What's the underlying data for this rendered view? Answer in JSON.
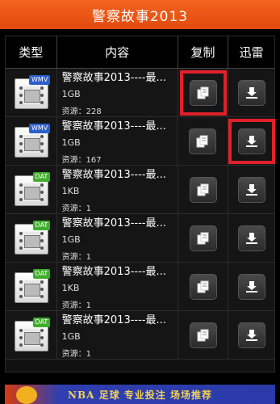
{
  "title": "警察故事2013",
  "headers": {
    "type": "类型",
    "content": "内容",
    "copy": "复制",
    "download": "迅雷"
  },
  "colors": {
    "title_bar": "#e94f12",
    "highlight": "#e0202a",
    "wmv_tag": "#2c5fc9",
    "dat_tag": "#3fae2a"
  },
  "rows": [
    {
      "type_tag": "WMV",
      "name": "警察故事2013----最...",
      "size": "1GB",
      "source": "资源：228"
    },
    {
      "type_tag": "WMV",
      "name": "警察故事2013----最...",
      "size": "1GB",
      "source": "资源：167"
    },
    {
      "type_tag": "DAT",
      "name": "警察故事2013----最...",
      "size": "1KB",
      "source": "资源：1"
    },
    {
      "type_tag": "DAT",
      "name": "警察故事2013----最...",
      "size": "1GB",
      "source": "资源：1"
    },
    {
      "type_tag": "DAT",
      "name": "警察故事2013----最...",
      "size": "1KB",
      "source": "资源：1"
    },
    {
      "type_tag": "DAT",
      "name": "警察故事2013----最...",
      "size": "1GB",
      "source": "资源：1"
    }
  ],
  "icons": {
    "copy": "copy-icon",
    "download": "download-icon",
    "file": "video-file-icon"
  },
  "ad": {
    "text": "NBA 足球 专业投注 场场推荐"
  }
}
